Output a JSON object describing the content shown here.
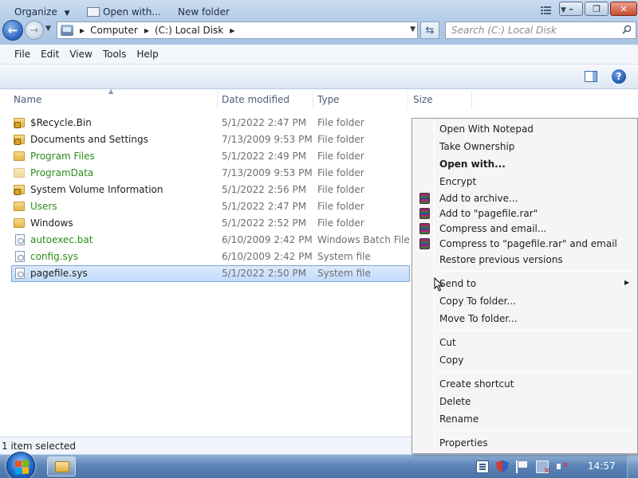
{
  "window": {
    "minimize_symbol": "–",
    "maximize_symbol": "❐",
    "close_symbol": "✕"
  },
  "address_bar": {
    "breadcrumbs": [
      "Computer",
      "(C:) Local Disk"
    ],
    "search_placeholder": "Search (C:) Local Disk"
  },
  "menu": [
    "File",
    "Edit",
    "View",
    "Tools",
    "Help"
  ],
  "commands": {
    "organize": "Organize",
    "open_with": "Open with...",
    "new_folder": "New folder"
  },
  "columns": [
    "Name",
    "Date modified",
    "Type",
    "Size"
  ],
  "files": [
    {
      "name": "$Recycle.Bin",
      "date": "5/1/2022 2:47 PM",
      "type": "File folder",
      "icon": "locked-folder-icon"
    },
    {
      "name": "Documents and Settings",
      "date": "7/13/2009 9:53 PM",
      "type": "File folder",
      "icon": "locked-folder-icon"
    },
    {
      "name": "Program Files",
      "date": "5/1/2022 2:49 PM",
      "type": "File folder",
      "icon": "folder-icon"
    },
    {
      "name": "ProgramData",
      "date": "7/13/2009 9:53 PM",
      "type": "File folder",
      "icon": "hidden-folder-icon"
    },
    {
      "name": "System Volume Information",
      "date": "5/1/2022 2:56 PM",
      "type": "File folder",
      "icon": "locked-folder-icon"
    },
    {
      "name": "Users",
      "date": "5/1/2022 2:47 PM",
      "type": "File folder",
      "icon": "folder-icon"
    },
    {
      "name": "Windows",
      "date": "5/1/2022 2:52 PM",
      "type": "File folder",
      "icon": "folder-icon"
    },
    {
      "name": "autoexec.bat",
      "date": "6/10/2009 2:42 PM",
      "type": "Windows Batch File",
      "icon": "system-file-icon"
    },
    {
      "name": "config.sys",
      "date": "6/10/2009 2:42 PM",
      "type": "System file",
      "icon": "system-file-icon"
    },
    {
      "name": "pagefile.sys",
      "date": "5/1/2022 2:50 PM",
      "type": "System file",
      "icon": "system-file-icon"
    }
  ],
  "status": "1 item selected",
  "context_menu": [
    {
      "label": "Open With Notepad"
    },
    {
      "label": "Take Ownership"
    },
    {
      "label": "Open with..."
    },
    {
      "label": "Encrypt"
    },
    {
      "label": "Add to archive..."
    },
    {
      "label": "Add to \"pagefile.rar\""
    },
    {
      "label": "Compress and email..."
    },
    {
      "label": "Compress to \"pagefile.rar\" and email"
    },
    {
      "label": "Restore previous versions"
    },
    {
      "label": "Send to"
    },
    {
      "label": "Copy To folder..."
    },
    {
      "label": "Move To folder..."
    },
    {
      "label": "Cut"
    },
    {
      "label": "Copy"
    },
    {
      "label": "Create shortcut"
    },
    {
      "label": "Delete"
    },
    {
      "label": "Rename"
    },
    {
      "label": "Properties"
    }
  ],
  "taskbar": {
    "clock": "14:57"
  },
  "colors": {
    "system_item_green": "#2e8b1a",
    "selection_fill": "#c1dbfc",
    "selection_border": "#7da2ce"
  }
}
